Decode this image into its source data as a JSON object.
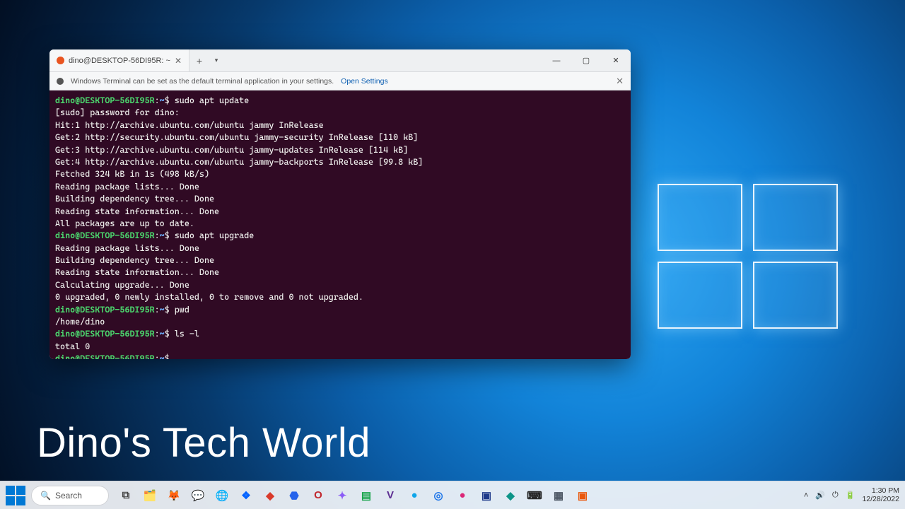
{
  "window": {
    "tab_title": "dino@DESKTOP-56DI95R: ~",
    "infobar_text": "Windows Terminal can be set as the default terminal application in your settings.",
    "infobar_link": "Open Settings",
    "controls": {
      "min": "—",
      "max": "▢",
      "close": "✕"
    }
  },
  "prompt": {
    "user_host": "dino@DESKTOP-56DI95R",
    "path": "~",
    "sep": ":",
    "symbol": "$"
  },
  "session": [
    {
      "type": "cmd",
      "text": "sudo apt update"
    },
    {
      "type": "out",
      "text": "[sudo] password for dino:"
    },
    {
      "type": "out",
      "text": "Hit:1 http://archive.ubuntu.com/ubuntu jammy InRelease"
    },
    {
      "type": "out",
      "text": "Get:2 http://security.ubuntu.com/ubuntu jammy-security InRelease [110 kB]"
    },
    {
      "type": "out",
      "text": "Get:3 http://archive.ubuntu.com/ubuntu jammy-updates InRelease [114 kB]"
    },
    {
      "type": "out",
      "text": "Get:4 http://archive.ubuntu.com/ubuntu jammy-backports InRelease [99.8 kB]"
    },
    {
      "type": "out",
      "text": "Fetched 324 kB in 1s (498 kB/s)"
    },
    {
      "type": "out",
      "text": "Reading package lists... Done"
    },
    {
      "type": "out",
      "text": "Building dependency tree... Done"
    },
    {
      "type": "out",
      "text": "Reading state information... Done"
    },
    {
      "type": "out",
      "text": "All packages are up to date."
    },
    {
      "type": "cmd",
      "text": "sudo apt upgrade"
    },
    {
      "type": "out",
      "text": "Reading package lists... Done"
    },
    {
      "type": "out",
      "text": "Building dependency tree... Done"
    },
    {
      "type": "out",
      "text": "Reading state information... Done"
    },
    {
      "type": "out",
      "text": "Calculating upgrade... Done"
    },
    {
      "type": "out",
      "text": "0 upgraded, 0 newly installed, 0 to remove and 0 not upgraded."
    },
    {
      "type": "cmd",
      "text": "pwd"
    },
    {
      "type": "out",
      "text": "/home/dino"
    },
    {
      "type": "cmd",
      "text": "ls -l"
    },
    {
      "type": "out",
      "text": "total 0"
    },
    {
      "type": "cmd",
      "text": ""
    }
  ],
  "watermark": "Dino's Tech World",
  "taskbar": {
    "search_placeholder": "Search",
    "tray": {
      "chevron": "˄",
      "sound": "🔊",
      "wifi": "⏻",
      "battery": "🔋",
      "time": "1:30 PM",
      "date": "12/28/2022"
    },
    "apps": [
      {
        "name": "task-view-icon",
        "glyph": "⧉",
        "color": "#444"
      },
      {
        "name": "file-explorer-icon",
        "glyph": "🗂️",
        "color": ""
      },
      {
        "name": "firefox-icon",
        "glyph": "🦊",
        "color": ""
      },
      {
        "name": "chat-icon",
        "glyph": "💬",
        "color": ""
      },
      {
        "name": "edge-icon",
        "glyph": "🌐",
        "color": "#0b6fb8"
      },
      {
        "name": "dropbox-icon",
        "glyph": "❖",
        "color": "#0061ff"
      },
      {
        "name": "app-icon-1",
        "glyph": "◆",
        "color": "#d93a2b"
      },
      {
        "name": "app-icon-2",
        "glyph": "⬣",
        "color": "#2563eb"
      },
      {
        "name": "opera-icon",
        "glyph": "O",
        "color": "#c1272d"
      },
      {
        "name": "app-icon-3",
        "glyph": "✦",
        "color": "#8b5cf6"
      },
      {
        "name": "app-icon-4",
        "glyph": "▤",
        "color": "#16a34a"
      },
      {
        "name": "vs-icon",
        "glyph": "V",
        "color": "#5c2d91"
      },
      {
        "name": "app-icon-5",
        "glyph": "●",
        "color": "#0ea5e9"
      },
      {
        "name": "chrome-icon",
        "glyph": "◎",
        "color": "#1a73e8"
      },
      {
        "name": "app-icon-6",
        "glyph": "●",
        "color": "#db2777"
      },
      {
        "name": "vbox-icon",
        "glyph": "▣",
        "color": "#1e3a8a"
      },
      {
        "name": "app-icon-7",
        "glyph": "◆",
        "color": "#0d9488"
      },
      {
        "name": "terminal-icon",
        "glyph": "⌨",
        "color": "#222"
      },
      {
        "name": "app-icon-8",
        "glyph": "▦",
        "color": "#4b5563"
      },
      {
        "name": "recorder-icon",
        "glyph": "▣",
        "color": "#ea580c"
      }
    ]
  }
}
